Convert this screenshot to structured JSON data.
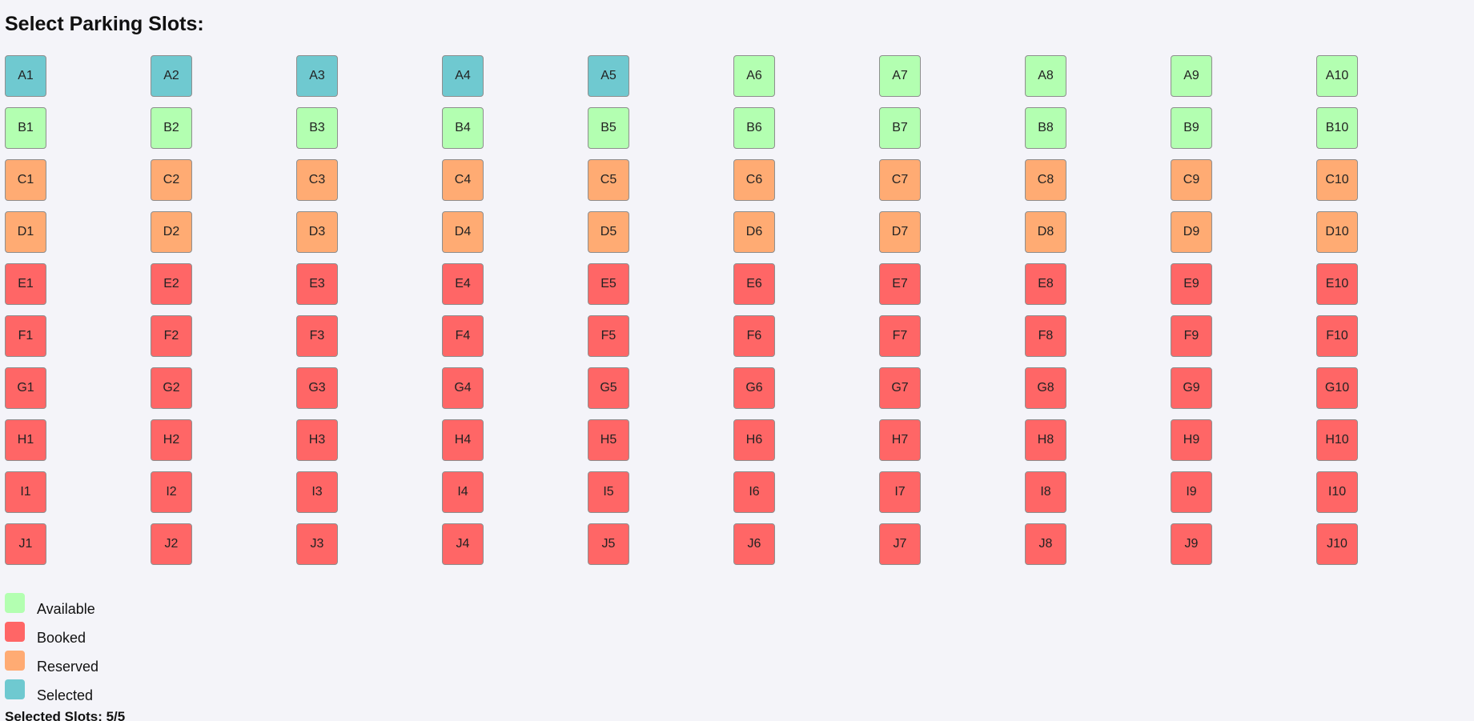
{
  "page": {
    "title": "Select Parking Slots:"
  },
  "colors": {
    "available": "#b3ffb1",
    "booked": "#ff6666",
    "reserved": "#ffab73",
    "selected": "#6fc9d0"
  },
  "slots": [
    {
      "id": "A1",
      "status": "selected"
    },
    {
      "id": "A2",
      "status": "selected"
    },
    {
      "id": "A3",
      "status": "selected"
    },
    {
      "id": "A4",
      "status": "selected"
    },
    {
      "id": "A5",
      "status": "selected"
    },
    {
      "id": "A6",
      "status": "available"
    },
    {
      "id": "A7",
      "status": "available"
    },
    {
      "id": "A8",
      "status": "available"
    },
    {
      "id": "A9",
      "status": "available"
    },
    {
      "id": "A10",
      "status": "available"
    },
    {
      "id": "B1",
      "status": "available"
    },
    {
      "id": "B2",
      "status": "available"
    },
    {
      "id": "B3",
      "status": "available"
    },
    {
      "id": "B4",
      "status": "available"
    },
    {
      "id": "B5",
      "status": "available"
    },
    {
      "id": "B6",
      "status": "available"
    },
    {
      "id": "B7",
      "status": "available"
    },
    {
      "id": "B8",
      "status": "available"
    },
    {
      "id": "B9",
      "status": "available"
    },
    {
      "id": "B10",
      "status": "available"
    },
    {
      "id": "C1",
      "status": "reserved"
    },
    {
      "id": "C2",
      "status": "reserved"
    },
    {
      "id": "C3",
      "status": "reserved"
    },
    {
      "id": "C4",
      "status": "reserved"
    },
    {
      "id": "C5",
      "status": "reserved"
    },
    {
      "id": "C6",
      "status": "reserved"
    },
    {
      "id": "C7",
      "status": "reserved"
    },
    {
      "id": "C8",
      "status": "reserved"
    },
    {
      "id": "C9",
      "status": "reserved"
    },
    {
      "id": "C10",
      "status": "reserved"
    },
    {
      "id": "D1",
      "status": "reserved"
    },
    {
      "id": "D2",
      "status": "reserved"
    },
    {
      "id": "D3",
      "status": "reserved"
    },
    {
      "id": "D4",
      "status": "reserved"
    },
    {
      "id": "D5",
      "status": "reserved"
    },
    {
      "id": "D6",
      "status": "reserved"
    },
    {
      "id": "D7",
      "status": "reserved"
    },
    {
      "id": "D8",
      "status": "reserved"
    },
    {
      "id": "D9",
      "status": "reserved"
    },
    {
      "id": "D10",
      "status": "reserved"
    },
    {
      "id": "E1",
      "status": "booked"
    },
    {
      "id": "E2",
      "status": "booked"
    },
    {
      "id": "E3",
      "status": "booked"
    },
    {
      "id": "E4",
      "status": "booked"
    },
    {
      "id": "E5",
      "status": "booked"
    },
    {
      "id": "E6",
      "status": "booked"
    },
    {
      "id": "E7",
      "status": "booked"
    },
    {
      "id": "E8",
      "status": "booked"
    },
    {
      "id": "E9",
      "status": "booked"
    },
    {
      "id": "E10",
      "status": "booked"
    },
    {
      "id": "F1",
      "status": "booked"
    },
    {
      "id": "F2",
      "status": "booked"
    },
    {
      "id": "F3",
      "status": "booked"
    },
    {
      "id": "F4",
      "status": "booked"
    },
    {
      "id": "F5",
      "status": "booked"
    },
    {
      "id": "F6",
      "status": "booked"
    },
    {
      "id": "F7",
      "status": "booked"
    },
    {
      "id": "F8",
      "status": "booked"
    },
    {
      "id": "F9",
      "status": "booked"
    },
    {
      "id": "F10",
      "status": "booked"
    },
    {
      "id": "G1",
      "status": "booked"
    },
    {
      "id": "G2",
      "status": "booked"
    },
    {
      "id": "G3",
      "status": "booked"
    },
    {
      "id": "G4",
      "status": "booked"
    },
    {
      "id": "G5",
      "status": "booked"
    },
    {
      "id": "G6",
      "status": "booked"
    },
    {
      "id": "G7",
      "status": "booked"
    },
    {
      "id": "G8",
      "status": "booked"
    },
    {
      "id": "G9",
      "status": "booked"
    },
    {
      "id": "G10",
      "status": "booked"
    },
    {
      "id": "H1",
      "status": "booked"
    },
    {
      "id": "H2",
      "status": "booked"
    },
    {
      "id": "H3",
      "status": "booked"
    },
    {
      "id": "H4",
      "status": "booked"
    },
    {
      "id": "H5",
      "status": "booked"
    },
    {
      "id": "H6",
      "status": "booked"
    },
    {
      "id": "H7",
      "status": "booked"
    },
    {
      "id": "H8",
      "status": "booked"
    },
    {
      "id": "H9",
      "status": "booked"
    },
    {
      "id": "H10",
      "status": "booked"
    },
    {
      "id": "I1",
      "status": "booked"
    },
    {
      "id": "I2",
      "status": "booked"
    },
    {
      "id": "I3",
      "status": "booked"
    },
    {
      "id": "I4",
      "status": "booked"
    },
    {
      "id": "I5",
      "status": "booked"
    },
    {
      "id": "I6",
      "status": "booked"
    },
    {
      "id": "I7",
      "status": "booked"
    },
    {
      "id": "I8",
      "status": "booked"
    },
    {
      "id": "I9",
      "status": "booked"
    },
    {
      "id": "I10",
      "status": "booked"
    },
    {
      "id": "J1",
      "status": "booked"
    },
    {
      "id": "J2",
      "status": "booked"
    },
    {
      "id": "J3",
      "status": "booked"
    },
    {
      "id": "J4",
      "status": "booked"
    },
    {
      "id": "J5",
      "status": "booked"
    },
    {
      "id": "J6",
      "status": "booked"
    },
    {
      "id": "J7",
      "status": "booked"
    },
    {
      "id": "J8",
      "status": "booked"
    },
    {
      "id": "J9",
      "status": "booked"
    },
    {
      "id": "J10",
      "status": "booked"
    }
  ],
  "legend": [
    {
      "status": "available",
      "label": "Available"
    },
    {
      "status": "booked",
      "label": "Booked"
    },
    {
      "status": "reserved",
      "label": "Reserved"
    },
    {
      "status": "selected",
      "label": "Selected"
    }
  ],
  "summary": {
    "selected_text": "Selected Slots: 5/5"
  }
}
